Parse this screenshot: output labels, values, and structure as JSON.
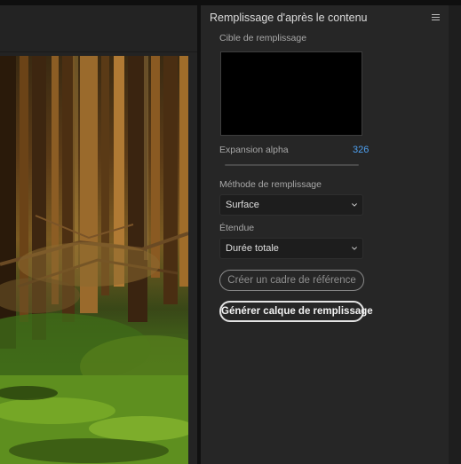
{
  "panel": {
    "title": "Remplissage d'après le contenu",
    "menu_icon": "hamburger-menu-icon"
  },
  "fill_target": {
    "label": "Cible de remplissage"
  },
  "alpha_expansion": {
    "label": "Expansion alpha",
    "value": "326"
  },
  "fill_method": {
    "label": "Méthode de remplissage",
    "selected": "Surface"
  },
  "range": {
    "label": "Étendue",
    "selected": "Durée totale"
  },
  "buttons": {
    "create_reference": "Créer un cadre de référence",
    "generate_fill_layer": "Générer calque de remplissage"
  },
  "colors": {
    "accent_value": "#4ea0f0",
    "panel_bg": "#262626",
    "dropdown_bg": "#1d1d1d"
  }
}
